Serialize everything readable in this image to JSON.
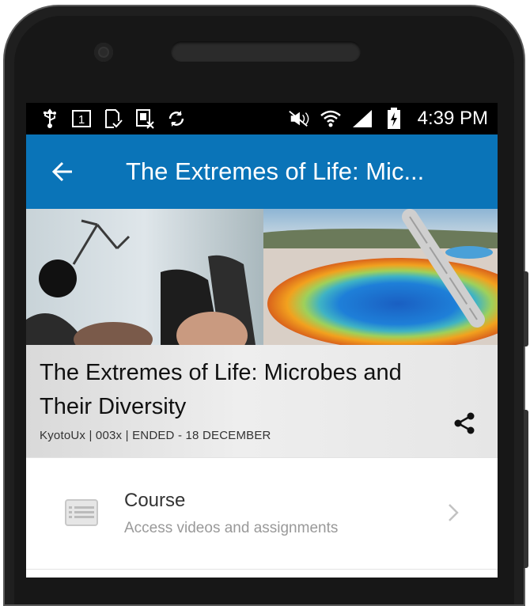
{
  "status_bar": {
    "time": "4:39 PM",
    "left_icons": [
      "usb-icon",
      "sim-1-icon",
      "download-done-icon",
      "sim-off-icon",
      "sync-icon"
    ],
    "right_icons": [
      "mute-icon",
      "wifi-icon",
      "signal-icon",
      "battery-charging-icon"
    ]
  },
  "app_bar": {
    "title": "The Extremes of Life: Mic...",
    "back_icon": "arrow-left-icon",
    "color": "#0a74b8"
  },
  "course_header": {
    "title": "The Extremes of Life: Microbes and Their Diversity",
    "meta": "KyotoUx | 003x | ENDED - 18 DECEMBER",
    "share_icon": "share-icon"
  },
  "menu": {
    "items": [
      {
        "title": "Course",
        "subtitle": "Access videos and assignments",
        "icon": "list-icon"
      }
    ]
  }
}
